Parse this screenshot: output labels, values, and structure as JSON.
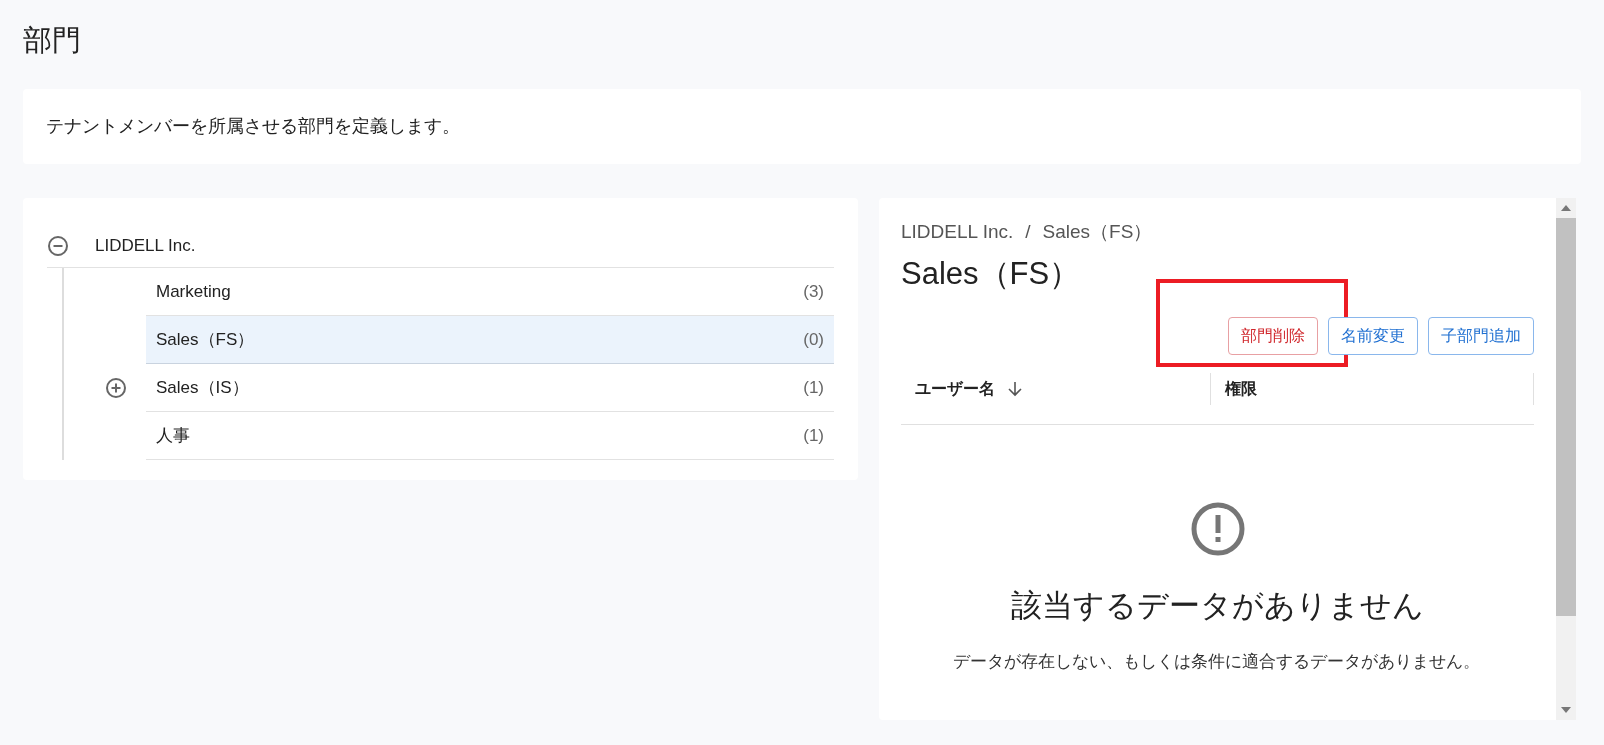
{
  "page_title": "部門",
  "description": "テナントメンバーを所属させる部門を定義します。",
  "tree": {
    "root": {
      "label": "LIDDELL Inc.",
      "expanded": true,
      "children": [
        {
          "label": "Marketing",
          "count": "(3)",
          "selected": false,
          "expandable": false
        },
        {
          "label": "Sales（FS）",
          "count": "(0)",
          "selected": true,
          "expandable": false
        },
        {
          "label": "Sales（IS）",
          "count": "(1)",
          "selected": false,
          "expandable": true,
          "expanded": false
        },
        {
          "label": "人事",
          "count": "(1)",
          "selected": false,
          "expandable": false
        }
      ]
    }
  },
  "detail": {
    "breadcrumb": [
      {
        "label": "LIDDELL Inc."
      },
      {
        "label": "Sales（FS）"
      }
    ],
    "breadcrumb_separator": "/",
    "heading": "Sales（FS）",
    "buttons": [
      {
        "label": "部門削除",
        "kind": "danger"
      },
      {
        "label": "名前変更",
        "kind": "primary"
      },
      {
        "label": "子部門追加",
        "kind": "primary"
      }
    ],
    "table": {
      "columns": [
        {
          "label": "ユーザー名",
          "sorted": true
        },
        {
          "label": "権限",
          "sorted": false
        }
      ]
    },
    "empty_state": {
      "title": "該当するデータがありません",
      "message": "データが存在しない、もしくは条件に適合するデータがありません。"
    }
  },
  "annotation": {
    "kind": "highlight"
  }
}
